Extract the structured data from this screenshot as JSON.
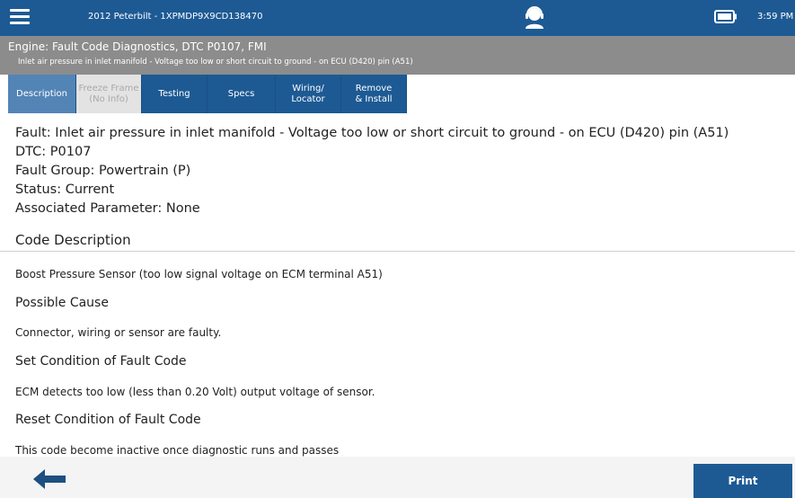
{
  "topbar": {
    "vehicle": "2012 Peterbilt - 1XPMDP9X9CD138470",
    "time": "3:59 PM",
    "icons": [
      "menu-icon",
      "support-agent-icon",
      "battery-icon"
    ]
  },
  "header": {
    "title": "Engine: Fault Code Diagnostics, DTC P0107, FMI",
    "subtitle": "Inlet air pressure in inlet manifold - Voltage too low or short circuit to ground - on ECU (D420) pin (A51)"
  },
  "tabs": [
    {
      "line1": "Description",
      "line2": "",
      "state": "active"
    },
    {
      "line1": "Freeze Frame",
      "line2": "(No Info)",
      "state": "disabled"
    },
    {
      "line1": "Testing",
      "line2": "",
      "state": "normal"
    },
    {
      "line1": "Specs",
      "line2": "",
      "state": "normal"
    },
    {
      "line1": "Wiring/",
      "line2": "Locator",
      "state": "normal"
    },
    {
      "line1": "Remove",
      "line2": "& Install",
      "state": "normal"
    }
  ],
  "fault": {
    "fault_line": "Fault: Inlet air pressure in inlet manifold - Voltage too low or short circuit to ground - on ECU (D420) pin (A51)",
    "dtc": "DTC: P0107",
    "group": "Fault Group: Powertrain (P)",
    "status": "Status: Current",
    "param": "Associated Parameter: None"
  },
  "code_description": {
    "heading": "Code Description",
    "text": "Boost Pressure Sensor (too low signal voltage on ECM terminal A51)",
    "possible_cause_heading": "Possible Cause",
    "possible_cause_text": "Connector, wiring or sensor are faulty.",
    "set_condition_heading": "Set Condition of Fault Code",
    "set_condition_text": "ECM detects too low (less than 0.20 Volt) output voltage of sensor.",
    "reset_condition_heading": "Reset Condition of Fault Code",
    "reset_condition_text": "This code become inactive once diagnostic runs and passes"
  },
  "bottom": {
    "print_label": "Print"
  }
}
